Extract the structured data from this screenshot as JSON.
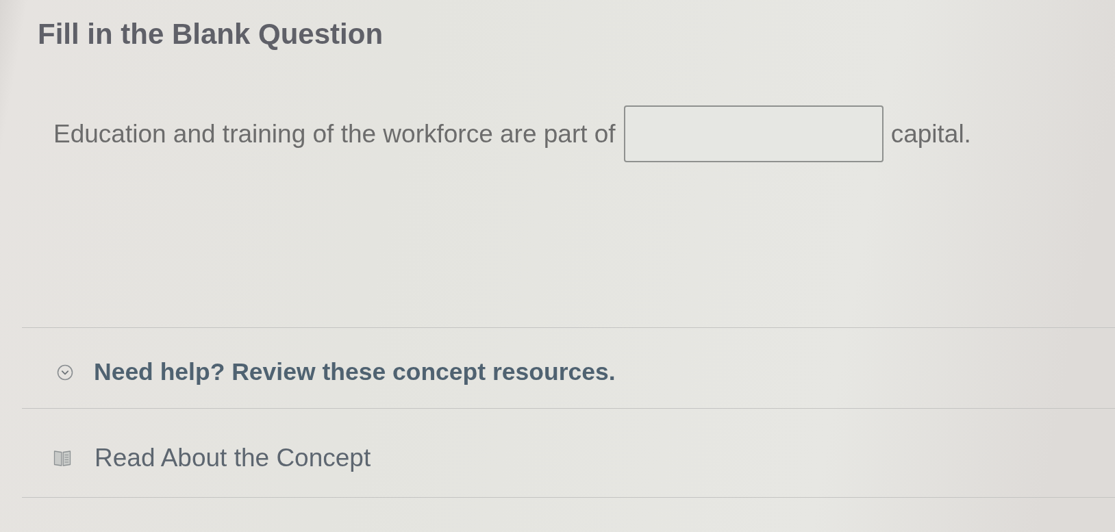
{
  "title": "Fill in the Blank Question",
  "question": [
    {
      "kind": "text",
      "text": "Education and training of the workforce are part of"
    },
    {
      "kind": "blank"
    },
    {
      "kind": "text",
      "text": "capital."
    }
  ],
  "help": {
    "label": "Need help? Review these concept resources.",
    "expanded": true
  },
  "resources": [
    {
      "label": "Read About the Concept"
    }
  ]
}
